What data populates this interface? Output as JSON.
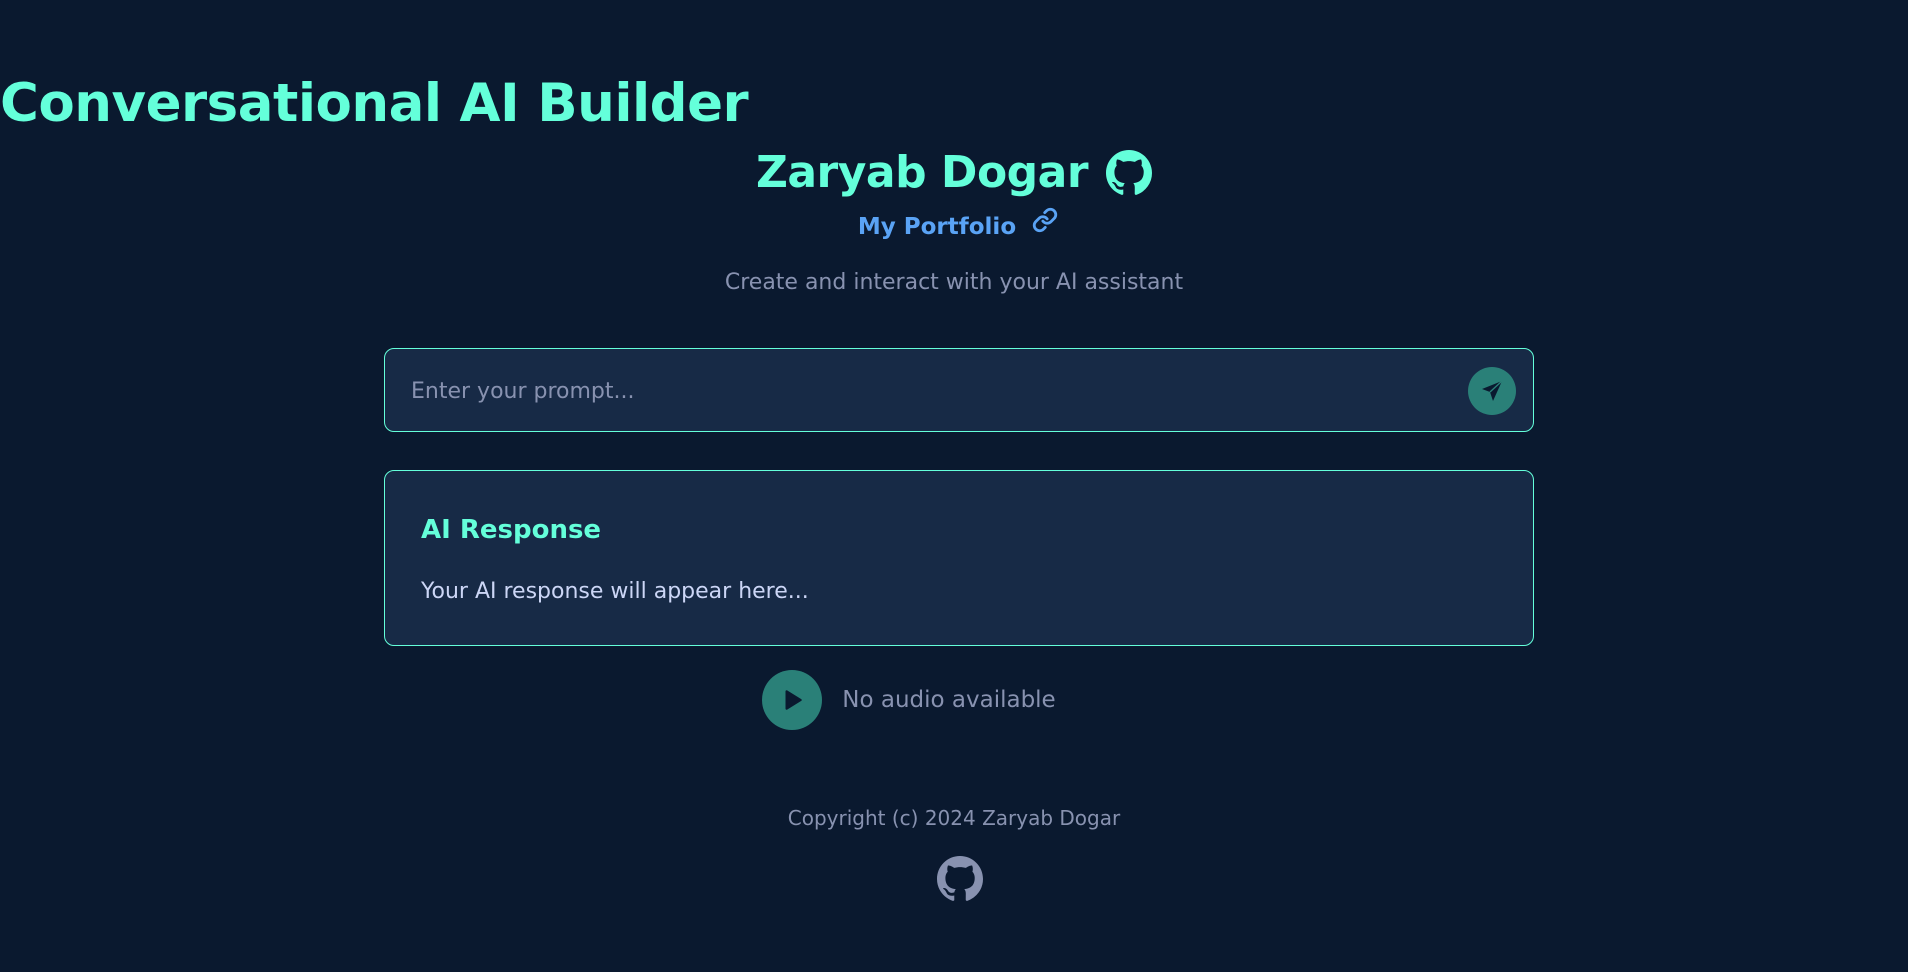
{
  "header": {
    "title": "Conversational AI Builder",
    "author": "Zaryab Dogar",
    "portfolio_label": "My Portfolio",
    "subtitle": "Create and interact with your AI assistant"
  },
  "prompt": {
    "placeholder": "Enter your prompt...",
    "value": ""
  },
  "response": {
    "title": "AI Response",
    "text": "Your AI response will appear here..."
  },
  "audio": {
    "status": "No audio available"
  },
  "footer": {
    "copyright": "Copyright (c) 2024 Zaryab Dogar"
  },
  "icons": {
    "author_github": "github-icon",
    "portfolio_link": "link-icon",
    "send": "paper-plane-icon",
    "play": "play-icon",
    "footer_github": "github-icon"
  },
  "colors": {
    "background": "#0a192f",
    "accent": "#64ffda",
    "panel": "#172a46",
    "link": "#5aa3f5",
    "muted": "#8892b0",
    "button": "#2a8078",
    "text": "#ccd6f6"
  }
}
